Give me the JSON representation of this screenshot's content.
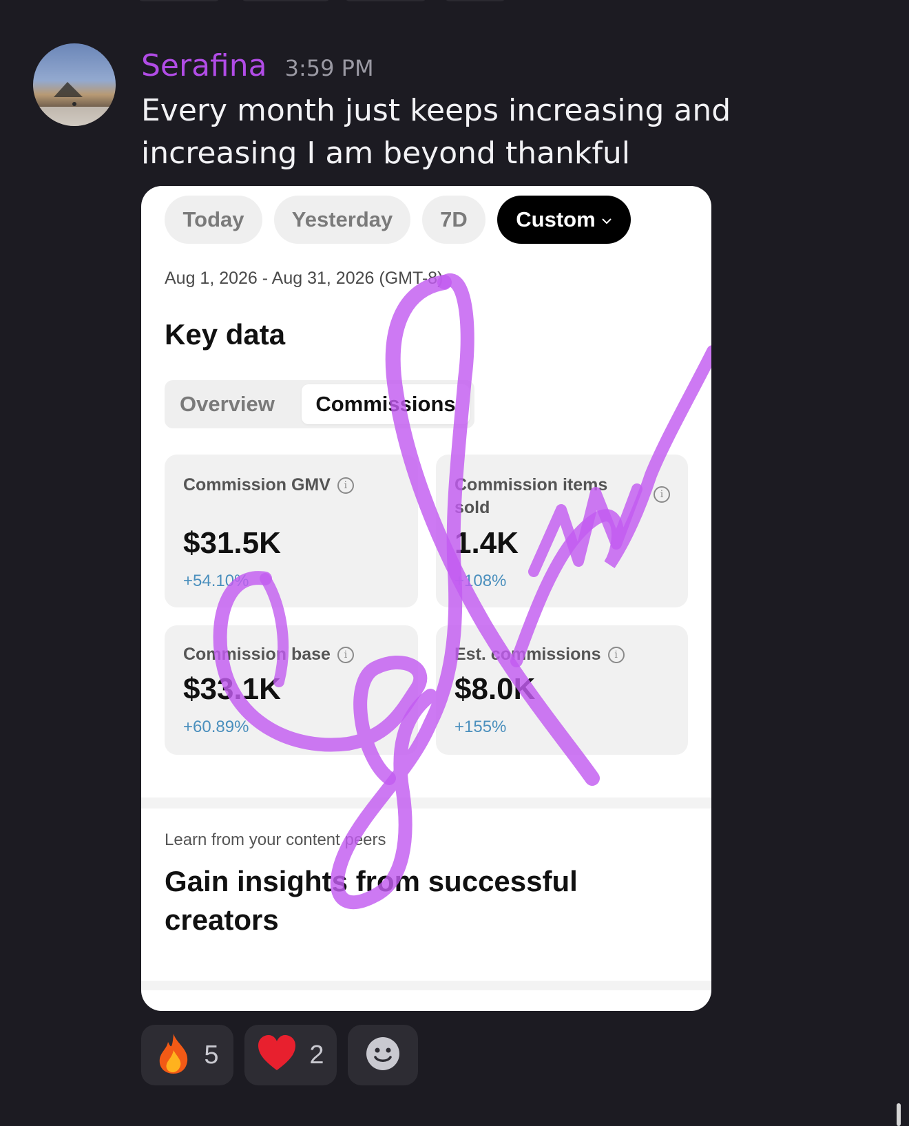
{
  "message": {
    "username": "Serafina",
    "timestamp": "3:59 PM",
    "text": "Every month just keeps increasing and increasing I am beyond thankful",
    "avatar_icon": "avatar-photo"
  },
  "colors": {
    "username": "#b14ce6",
    "background": "#1c1b22",
    "scribble": "#c25cf0",
    "change_positive": "#4a8fbd"
  },
  "screenshot": {
    "date_tabs": [
      {
        "label": "Today",
        "active": false
      },
      {
        "label": "Yesterday",
        "active": false
      },
      {
        "label": "7D",
        "active": false
      },
      {
        "label": "Custom",
        "active": true,
        "icon": "chevron-down-icon"
      }
    ],
    "date_range": "Aug 1, 2026 - Aug 31, 2026 (GMT-8)",
    "section_title": "Key data",
    "segments": [
      {
        "label": "Overview",
        "active": false
      },
      {
        "label": "Commissions",
        "active": true
      }
    ],
    "metrics": [
      {
        "label": "Commission GMV",
        "value": "$31.5K",
        "change": "+54.10%"
      },
      {
        "label": "Commission items sold",
        "value": "1.4K",
        "change": "+108%"
      },
      {
        "label": "Commission base",
        "value": "$33.1K",
        "change": "+60.89%"
      },
      {
        "label": "Est. commissions",
        "value": "$8.0K",
        "change": "+155%"
      }
    ],
    "peers_subtitle": "Learn from your content peers",
    "peers_title": "Gain insights from successful creators"
  },
  "reactions": [
    {
      "icon": "fire-icon",
      "emoji": "🔥",
      "count": "5"
    },
    {
      "icon": "heart-icon",
      "emoji": "❤️",
      "count": "2"
    },
    {
      "icon": "add-reaction-icon",
      "emoji": "",
      "count": ""
    }
  ]
}
